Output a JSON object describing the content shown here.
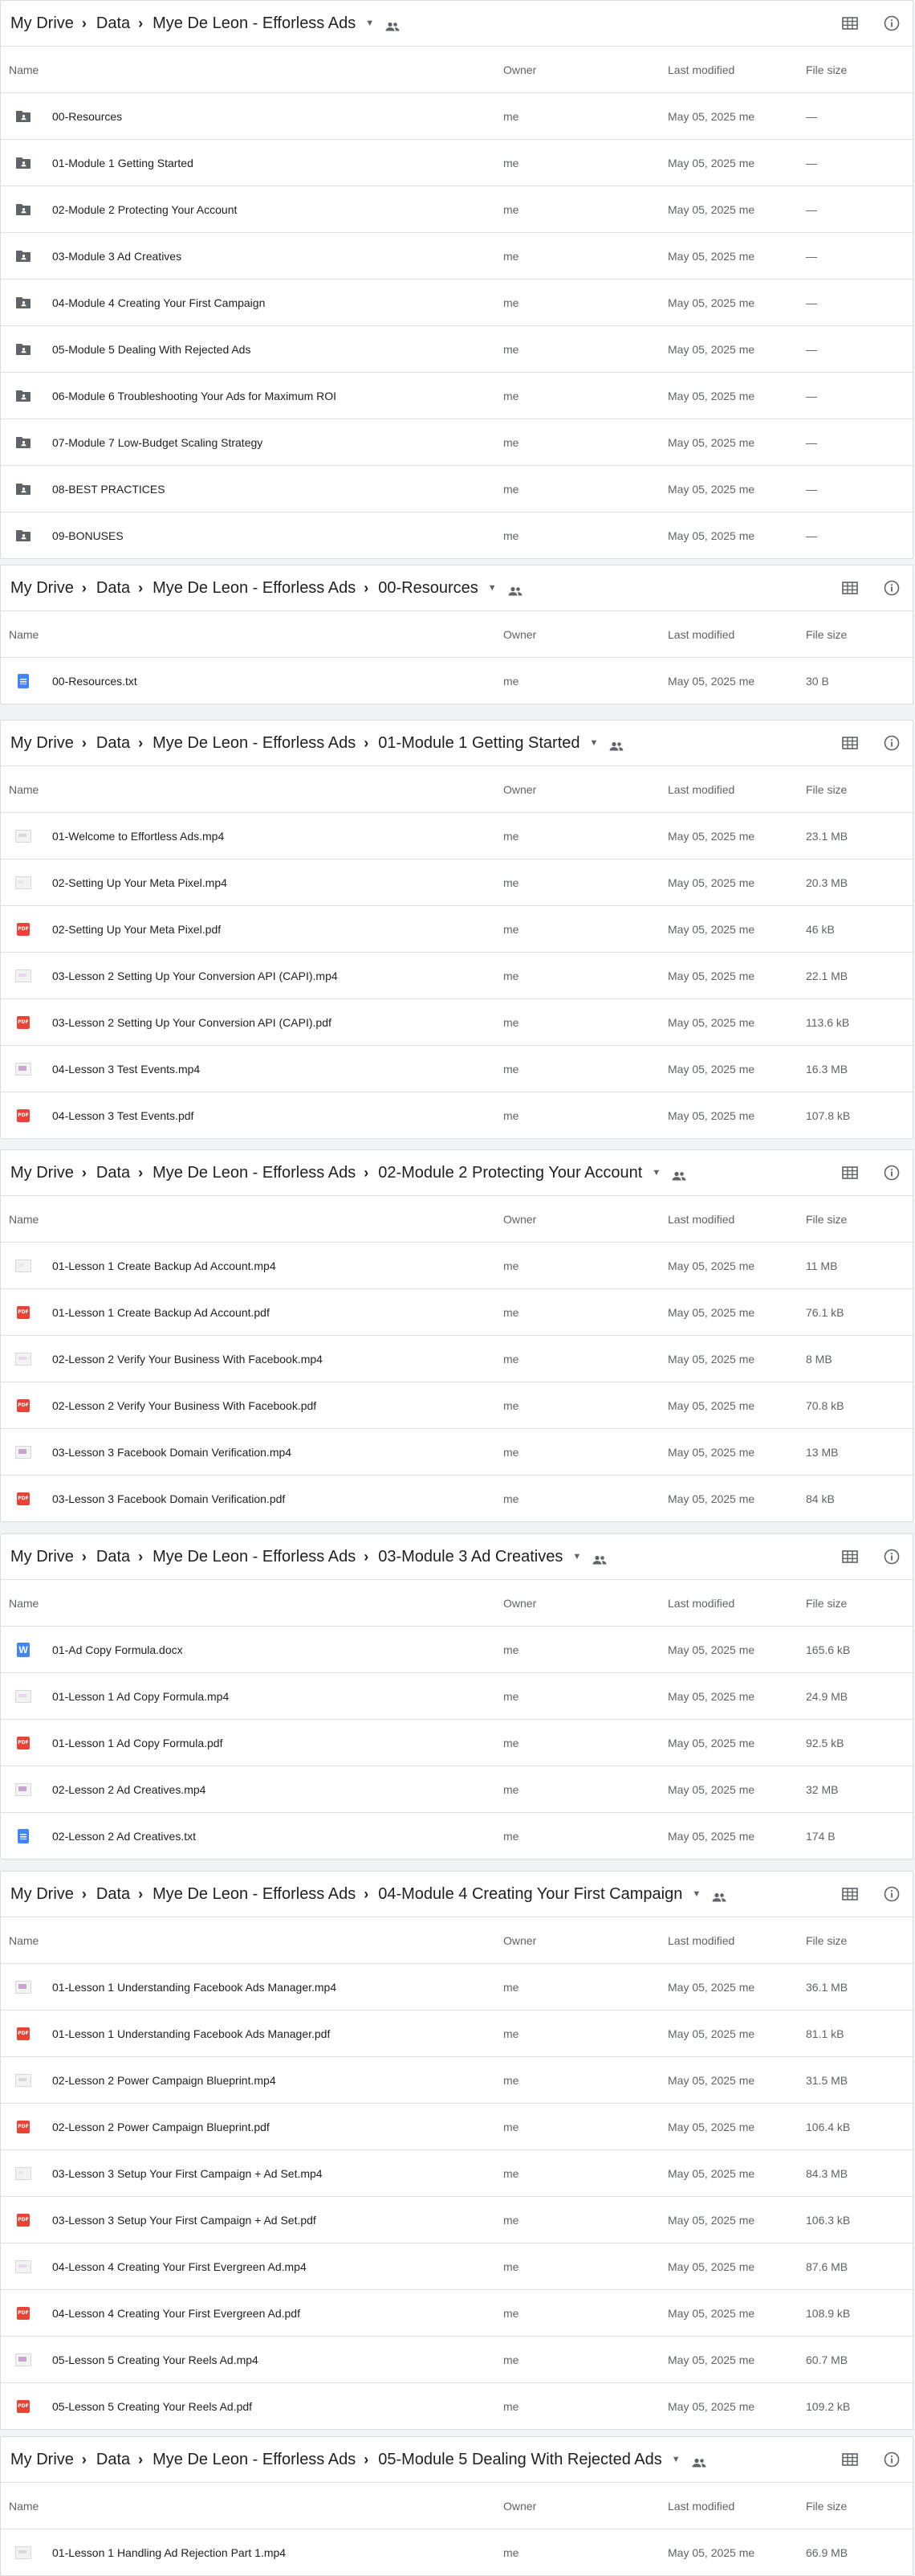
{
  "columns": {
    "name": "Name",
    "owner": "Owner",
    "modified": "Last modified",
    "size": "File size"
  },
  "panels": [
    {
      "breadcrumb": [
        "My Drive",
        "Data",
        "Mye De Leon - Efforless Ads"
      ],
      "rows": [
        {
          "icon": "folder-shared-icon",
          "name": "00-Resources",
          "owner": "me",
          "modified": "May 05, 2025 me",
          "size": "—"
        },
        {
          "icon": "folder-shared-icon",
          "name": "01-Module 1 Getting Started",
          "owner": "me",
          "modified": "May 05, 2025 me",
          "size": "—"
        },
        {
          "icon": "folder-shared-icon",
          "name": "02-Module 2 Protecting Your Account",
          "owner": "me",
          "modified": "May 05, 2025 me",
          "size": "—"
        },
        {
          "icon": "folder-shared-icon",
          "name": "03-Module 3 Ad Creatives",
          "owner": "me",
          "modified": "May 05, 2025 me",
          "size": "—"
        },
        {
          "icon": "folder-shared-icon",
          "name": "04-Module 4 Creating Your First Campaign",
          "owner": "me",
          "modified": "May 05, 2025 me",
          "size": "—"
        },
        {
          "icon": "folder-shared-icon",
          "name": "05-Module 5 Dealing With Rejected Ads",
          "owner": "me",
          "modified": "May 05, 2025 me",
          "size": "—"
        },
        {
          "icon": "folder-shared-icon",
          "name": "06-Module 6 Troubleshooting Your Ads for Maximum ROI",
          "owner": "me",
          "modified": "May 05, 2025 me",
          "size": "—"
        },
        {
          "icon": "folder-shared-icon",
          "name": "07-Module 7 Low-Budget Scaling Strategy",
          "owner": "me",
          "modified": "May 05, 2025 me",
          "size": "—"
        },
        {
          "icon": "folder-shared-icon",
          "name": "08-BEST PRACTICES",
          "owner": "me",
          "modified": "May 05, 2025 me",
          "size": "—"
        },
        {
          "icon": "folder-shared-icon",
          "name": "09-BONUSES",
          "owner": "me",
          "modified": "May 05, 2025 me",
          "size": "—"
        }
      ]
    },
    {
      "breadcrumb": [
        "My Drive",
        "Data",
        "Mye De Leon - Efforless Ads",
        "00-Resources"
      ],
      "rows": [
        {
          "icon": "text-file-icon",
          "name": "00-Resources.txt",
          "owner": "me",
          "modified": "May 05, 2025 me",
          "size": "30 B"
        }
      ]
    },
    {
      "breadcrumb": [
        "My Drive",
        "Data",
        "Mye De Leon - Efforless Ads",
        "01-Module 1 Getting Started"
      ],
      "rows": [
        {
          "icon": "video-thumbnail-icon",
          "name": "01-Welcome to Effortless Ads.mp4",
          "owner": "me",
          "modified": "May 05, 2025 me",
          "size": "23.1 MB"
        },
        {
          "icon": "video-thumbnail-icon",
          "name": "02-Setting Up Your Meta Pixel.mp4",
          "owner": "me",
          "modified": "May 05, 2025 me",
          "size": "20.3 MB"
        },
        {
          "icon": "pdf-icon",
          "name": "02-Setting Up Your Meta Pixel.pdf",
          "owner": "me",
          "modified": "May 05, 2025 me",
          "size": "46 kB"
        },
        {
          "icon": "video-thumbnail-icon",
          "name": "03-Lesson 2 Setting Up Your Conversion API (CAPI).mp4",
          "owner": "me",
          "modified": "May 05, 2025 me",
          "size": "22.1 MB"
        },
        {
          "icon": "pdf-icon",
          "name": "03-Lesson 2 Setting Up Your Conversion API (CAPI).pdf",
          "owner": "me",
          "modified": "May 05, 2025 me",
          "size": "113.6 kB"
        },
        {
          "icon": "video-thumbnail-icon",
          "name": "04-Lesson 3 Test Events.mp4",
          "owner": "me",
          "modified": "May 05, 2025 me",
          "size": "16.3 MB"
        },
        {
          "icon": "pdf-icon",
          "name": "04-Lesson 3 Test Events.pdf",
          "owner": "me",
          "modified": "May 05, 2025 me",
          "size": "107.8 kB"
        }
      ]
    },
    {
      "breadcrumb": [
        "My Drive",
        "Data",
        "Mye De Leon - Efforless Ads",
        "02-Module 2 Protecting Your Account"
      ],
      "rows": [
        {
          "icon": "video-thumbnail-icon",
          "name": "01-Lesson 1 Create Backup Ad Account.mp4",
          "owner": "me",
          "modified": "May 05, 2025 me",
          "size": "11 MB"
        },
        {
          "icon": "pdf-icon",
          "name": "01-Lesson 1 Create Backup Ad Account.pdf",
          "owner": "me",
          "modified": "May 05, 2025 me",
          "size": "76.1 kB"
        },
        {
          "icon": "video-thumbnail-icon",
          "name": "02-Lesson 2 Verify Your Business With Facebook.mp4",
          "owner": "me",
          "modified": "May 05, 2025 me",
          "size": "8 MB"
        },
        {
          "icon": "pdf-icon",
          "name": "02-Lesson 2 Verify Your Business With Facebook.pdf",
          "owner": "me",
          "modified": "May 05, 2025 me",
          "size": "70.8 kB"
        },
        {
          "icon": "video-thumbnail-icon",
          "name": "03-Lesson 3 Facebook Domain Verification.mp4",
          "owner": "me",
          "modified": "May 05, 2025 me",
          "size": "13 MB"
        },
        {
          "icon": "pdf-icon",
          "name": "03-Lesson 3 Facebook Domain Verification.pdf",
          "owner": "me",
          "modified": "May 05, 2025 me",
          "size": "84 kB"
        }
      ]
    },
    {
      "breadcrumb": [
        "My Drive",
        "Data",
        "Mye De Leon - Efforless Ads",
        "03-Module 3 Ad Creatives"
      ],
      "rows": [
        {
          "icon": "word-doc-icon",
          "name": "01-Ad Copy Formula.docx",
          "owner": "me",
          "modified": "May 05, 2025 me",
          "size": "165.6 kB"
        },
        {
          "icon": "video-thumbnail-icon",
          "name": "01-Lesson 1 Ad Copy Formula.mp4",
          "owner": "me",
          "modified": "May 05, 2025 me",
          "size": "24.9 MB"
        },
        {
          "icon": "pdf-icon",
          "name": "01-Lesson 1 Ad Copy Formula.pdf",
          "owner": "me",
          "modified": "May 05, 2025 me",
          "size": "92.5 kB"
        },
        {
          "icon": "video-thumbnail-icon",
          "name": "02-Lesson 2 Ad Creatives.mp4",
          "owner": "me",
          "modified": "May 05, 2025 me",
          "size": "32 MB"
        },
        {
          "icon": "text-file-icon",
          "name": "02-Lesson 2 Ad Creatives.txt",
          "owner": "me",
          "modified": "May 05, 2025 me",
          "size": "174 B"
        }
      ]
    },
    {
      "breadcrumb": [
        "My Drive",
        "Data",
        "Mye De Leon - Efforless Ads",
        "04-Module 4 Creating Your First Campaign"
      ],
      "rows": [
        {
          "icon": "video-thumbnail-icon",
          "name": "01-Lesson 1 Understanding Facebook Ads Manager.mp4",
          "owner": "me",
          "modified": "May 05, 2025 me",
          "size": "36.1 MB"
        },
        {
          "icon": "pdf-icon",
          "name": "01-Lesson 1 Understanding Facebook Ads Manager.pdf",
          "owner": "me",
          "modified": "May 05, 2025 me",
          "size": "81.1 kB"
        },
        {
          "icon": "video-thumbnail-icon",
          "name": "02-Lesson 2 Power Campaign Blueprint.mp4",
          "owner": "me",
          "modified": "May 05, 2025 me",
          "size": "31.5 MB"
        },
        {
          "icon": "pdf-icon",
          "name": "02-Lesson 2 Power Campaign Blueprint.pdf",
          "owner": "me",
          "modified": "May 05, 2025 me",
          "size": "106.4 kB"
        },
        {
          "icon": "video-thumbnail-icon",
          "name": "03-Lesson 3 Setup Your First Campaign + Ad Set.mp4",
          "owner": "me",
          "modified": "May 05, 2025 me",
          "size": "84.3 MB"
        },
        {
          "icon": "pdf-icon",
          "name": "03-Lesson 3 Setup Your First Campaign + Ad Set.pdf",
          "owner": "me",
          "modified": "May 05, 2025 me",
          "size": "106.3 kB"
        },
        {
          "icon": "video-thumbnail-icon",
          "name": "04-Lesson 4 Creating Your First Evergreen Ad.mp4",
          "owner": "me",
          "modified": "May 05, 2025 me",
          "size": "87.6 MB"
        },
        {
          "icon": "pdf-icon",
          "name": "04-Lesson 4 Creating Your First Evergreen Ad.pdf",
          "owner": "me",
          "modified": "May 05, 2025 me",
          "size": "108.9 kB"
        },
        {
          "icon": "video-thumbnail-icon",
          "name": "05-Lesson 5 Creating Your Reels Ad.mp4",
          "owner": "me",
          "modified": "May 05, 2025 me",
          "size": "60.7 MB"
        },
        {
          "icon": "pdf-icon",
          "name": "05-Lesson 5 Creating Your Reels Ad.pdf",
          "owner": "me",
          "modified": "May 05, 2025 me",
          "size": "109.2 kB"
        }
      ]
    },
    {
      "breadcrumb": [
        "My Drive",
        "Data",
        "Mye De Leon - Efforless Ads",
        "05-Module 5 Dealing With Rejected Ads"
      ],
      "rows": [
        {
          "icon": "video-thumbnail-icon",
          "name": "01-Lesson 1 Handling Ad Rejection Part 1.mp4",
          "owner": "me",
          "modified": "May 05, 2025 me",
          "size": "66.9 MB"
        }
      ]
    }
  ]
}
